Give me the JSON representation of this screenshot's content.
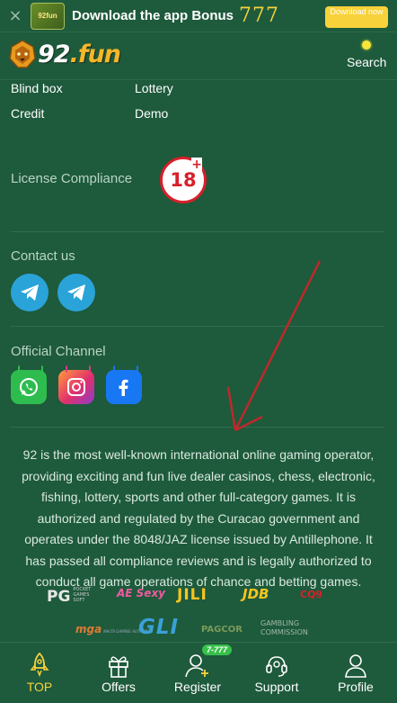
{
  "banner": {
    "close": "×",
    "app_thumb_text": "92fun",
    "text": "Download the app Bonus",
    "bonus": "777",
    "button_label": "Download now"
  },
  "header": {
    "logo_prefix": "92",
    "logo_suffix": ".fun",
    "search_label": "Search"
  },
  "links": {
    "blind_box": "Blind box",
    "lottery": "Lottery",
    "credit": "Credit",
    "demo": "Demo"
  },
  "license": {
    "title": "License Compliance",
    "badge": "18",
    "badge_plus": "+"
  },
  "contact": {
    "title": "Contact us",
    "icons": [
      "telegram-icon",
      "telegram-icon"
    ]
  },
  "channel": {
    "title": "Official Channel",
    "icons": [
      "whatsapp-icon",
      "instagram-icon",
      "facebook-icon"
    ]
  },
  "description": "92 is the most well-known international online gaming operator, providing exciting and fun live dealer casinos, chess, electronic, fishing, lottery, sports and other full-category games. It is authorized and regulated by the Curacao government and operates under the 8048/JAZ license issued by Antillephone. It has passed all compliance reviews and is legally authorized to conduct all game operations of chance and betting games.",
  "providers": {
    "pg": "PG",
    "pg_sub": "POCKET GAMES SOFT",
    "sexy": "AE Sexy",
    "jili": "JILI",
    "jdb": "JDB",
    "red": "CQ9",
    "mga": "mga",
    "mga_sub": "MALTA GAMING AUTHORITY",
    "gli": "GLI",
    "pagcor": "PAGCOR",
    "gambling": "GAMBLING",
    "gambling_sub": "COMMISSION"
  },
  "bottom_nav": {
    "items": [
      {
        "label": "TOP",
        "icon": "rocket-icon",
        "active": true
      },
      {
        "label": "Offers",
        "icon": "gift-icon",
        "active": false
      },
      {
        "label": "Register",
        "icon": "add-user-icon",
        "active": false,
        "badge": "7-777"
      },
      {
        "label": "Support",
        "icon": "headset-icon",
        "active": false
      },
      {
        "label": "Profile",
        "icon": "user-icon",
        "active": false
      }
    ]
  },
  "colors": {
    "background": "#1e5a3c",
    "accent": "#f7d23a",
    "arrow": "#c0282a",
    "badge_red": "#d8202a"
  }
}
